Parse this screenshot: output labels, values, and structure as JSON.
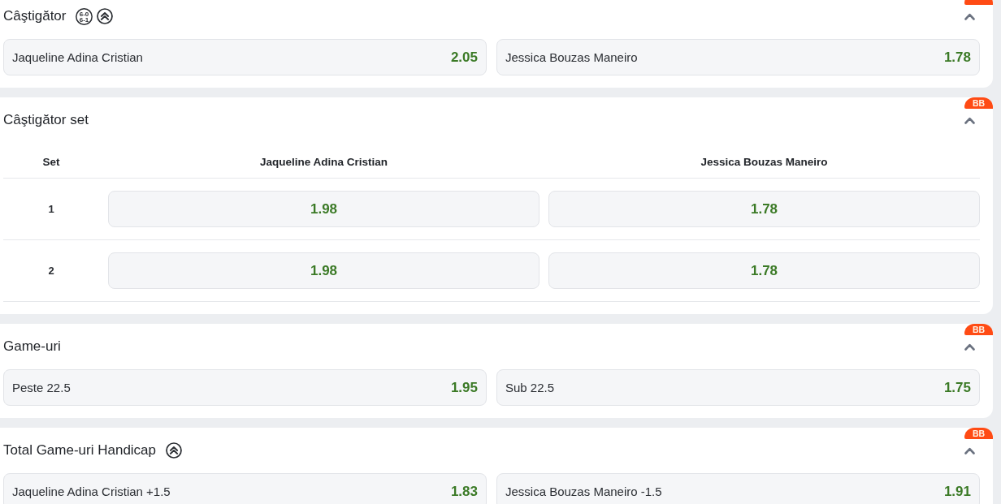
{
  "markets": [
    {
      "kind": "list",
      "title": "Câştigător",
      "badge_cut": true,
      "expanded": true,
      "title_icons": [
        {
          "kind": "scores",
          "lines": [
            "6-0",
            "6-1"
          ]
        },
        {
          "kind": "boost"
        }
      ],
      "selections": [
        {
          "label": "Jaqueline Adina Cristian",
          "odds": "2.05"
        },
        {
          "label": "Jessica Bouzas Maneiro",
          "odds": "1.78"
        }
      ]
    },
    {
      "kind": "table",
      "title": "Câştigător set",
      "badge": "BB",
      "expanded": true,
      "columns": [
        "Set",
        "Jaqueline Adina Cristian",
        "Jessica Bouzas Maneiro"
      ],
      "rows": [
        {
          "set": "1",
          "odds": [
            "1.98",
            "1.78"
          ]
        },
        {
          "set": "2",
          "odds": [
            "1.98",
            "1.78"
          ]
        }
      ]
    },
    {
      "kind": "list",
      "title": "Game-uri",
      "badge": "BB",
      "expanded": true,
      "selections": [
        {
          "label": "Peste 22.5",
          "odds": "1.95"
        },
        {
          "label": "Sub 22.5",
          "odds": "1.75"
        }
      ]
    },
    {
      "kind": "list",
      "title": "Total Game-uri Handicap",
      "badge": "BB",
      "expanded": true,
      "title_icons": [
        {
          "kind": "boost"
        }
      ],
      "selections": [
        {
          "label": "Jaqueline Adina Cristian +1.5",
          "odds": "1.83"
        },
        {
          "label": "Jessica Bouzas Maneiro -1.5",
          "odds": "1.91"
        }
      ]
    }
  ]
}
